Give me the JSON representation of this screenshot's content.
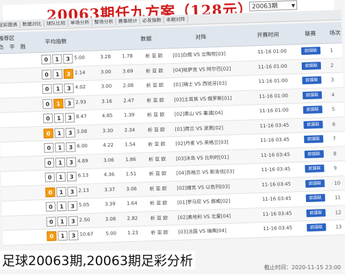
{
  "header": {
    "title": "20063期任九方案（128元）",
    "issue_select": "20063期"
  },
  "toolbar": [
    "足彩图表",
    "数据对比",
    "球队比较",
    "单场分析",
    "整场分析",
    "赛事统计",
    "必发指数",
    "本期对阵"
  ],
  "table": {
    "headers": {
      "pick_group": "推荐区",
      "lose": "负",
      "draw": "平",
      "win": "胜",
      "avg_odds": "平均指数",
      "data": "数据",
      "match": "对阵",
      "time": "开赛时间",
      "league": "联赛",
      "seq": "场次"
    },
    "rows": [
      {
        "seq": "1",
        "league": "欧国联",
        "time": "11-16 01:00",
        "match": "[01]白俄 VS 立陶宛[03]",
        "data": "析 亚 欧",
        "odds": [
          "1.78",
          "3.28",
          "5.00"
        ],
        "picks": [
          "3",
          "1",
          "0"
        ],
        "highlight": [
          false,
          false,
          false
        ]
      },
      {
        "seq": "2",
        "league": "欧国联",
        "time": "11-16 01:00",
        "match": "[04]哈萨克 VS 阿尔巴[02]",
        "data": "析 亚 欧",
        "odds": [
          "3.69",
          "3.00",
          "2.14"
        ],
        "picks": [
          "3",
          "1",
          "0"
        ],
        "highlight": [
          false,
          false,
          true
        ]
      },
      {
        "seq": "3",
        "league": "欧国联",
        "time": "11-16 01:00",
        "match": "[01]瑞士 VS 西班牙[03]",
        "data": "析 亚 欧",
        "odds": [
          "2.08",
          "3.00",
          "4.02"
        ],
        "picks": [
          "3",
          "1",
          "0"
        ],
        "highlight": [
          false,
          false,
          false
        ]
      },
      {
        "seq": "4",
        "league": "欧国联",
        "time": "11-16 01:00",
        "match": "[03]土耳其 VS 俄罗斯[01]",
        "data": "析 亚 欧",
        "odds": [
          "2.47",
          "3.16",
          "2.93"
        ],
        "picks": [
          "3",
          "1",
          "0"
        ],
        "highlight": [
          false,
          true,
          false
        ]
      },
      {
        "seq": "5",
        "league": "欧国联",
        "time": "11-16 01:00",
        "match": "[02]黑山 VS 塞浦[04]",
        "data": "析 亚 欧",
        "odds": [
          "1.39",
          "4.85",
          "8.47"
        ],
        "picks": [
          "3",
          "1",
          "0"
        ],
        "highlight": [
          false,
          false,
          false
        ]
      },
      {
        "seq": "6",
        "league": "欧国联",
        "time": "11-16 03:45",
        "match": "[01]荷兰 VS 波黑[02]",
        "data": "析 亚 欧",
        "odds": [
          "2.34",
          "3.30",
          "3.08"
        ],
        "picks": [
          "3",
          "1",
          "0"
        ],
        "highlight": [
          true,
          false,
          false
        ]
      },
      {
        "seq": "7",
        "league": "欧国联",
        "time": "11-16 03:45",
        "match": "[02]丹麦 VS 英格兰[03]",
        "data": "析 亚 欧",
        "odds": [
          "1.54",
          "4.22",
          "6.00"
        ],
        "picks": [
          "3",
          "1",
          "0"
        ],
        "highlight": [
          false,
          false,
          false
        ]
      },
      {
        "seq": "8",
        "league": "欧国联",
        "time": "11-16 03:45",
        "match": "[03]冰岛 VS 比利时[01]",
        "data": "析 亚 欧",
        "odds": [
          "1.86",
          "3.06",
          "4.89"
        ],
        "picks": [
          "3",
          "1",
          "0"
        ],
        "highlight": [
          false,
          false,
          false
        ]
      },
      {
        "seq": "9",
        "league": "欧国联",
        "time": "11-16 03:45",
        "match": "[04]苏格兰 VS 斯洛伐[03]",
        "data": "析 亚 欧",
        "odds": [
          "1.51",
          "4.36",
          "6.13"
        ],
        "picks": [
          "3",
          "1",
          "0"
        ],
        "highlight": [
          false,
          false,
          false
        ]
      },
      {
        "seq": "10",
        "league": "欧国联",
        "time": "11-16 03:45",
        "match": "[02]捷克 VS 以色列[03]",
        "data": "析 亚 欧",
        "odds": [
          "3.06",
          "3.37",
          "2.13"
        ],
        "picks": [
          "3",
          "1",
          "0"
        ],
        "highlight": [
          true,
          false,
          false
        ]
      },
      {
        "seq": "11",
        "league": "欧国联",
        "time": "11-16 03:45",
        "match": "[01]罗马尼 VS 挪威[02]",
        "data": "析 亚 欧",
        "odds": [
          "1.64",
          "3.39",
          "5.05"
        ],
        "picks": [
          "3",
          "1",
          "0"
        ],
        "highlight": [
          false,
          false,
          false
        ]
      },
      {
        "seq": "12",
        "league": "欧国联",
        "time": "11-16 03:45",
        "match": "[02]奥地利 VS 北爱[04]",
        "data": "析 亚 欧",
        "odds": [
          "2.82",
          "3.08",
          "2.50"
        ],
        "picks": [
          "3",
          "1",
          "0"
        ],
        "highlight": [
          false,
          false,
          false
        ]
      },
      {
        "seq": "13",
        "league": "欧国联",
        "time": "11-16 03:45",
        "match": "[03]法国 VS 瑞典[04]",
        "data": "析 亚 欧",
        "odds": [
          "1.23",
          "5.00",
          "10.67"
        ],
        "picks": [
          "3",
          "1",
          "0"
        ],
        "highlight": [
          true,
          false,
          false
        ]
      }
    ]
  },
  "footer": {
    "deadline": "截止时间：2020-11-15 23:00"
  },
  "caption": "足球20063期,20063期足彩分析",
  "colors": {
    "title_red": "#d11c1c",
    "header_bg": "#dfe6ee",
    "pick_highlight": "#f39c12",
    "analysis_button": "#2a63c4"
  }
}
